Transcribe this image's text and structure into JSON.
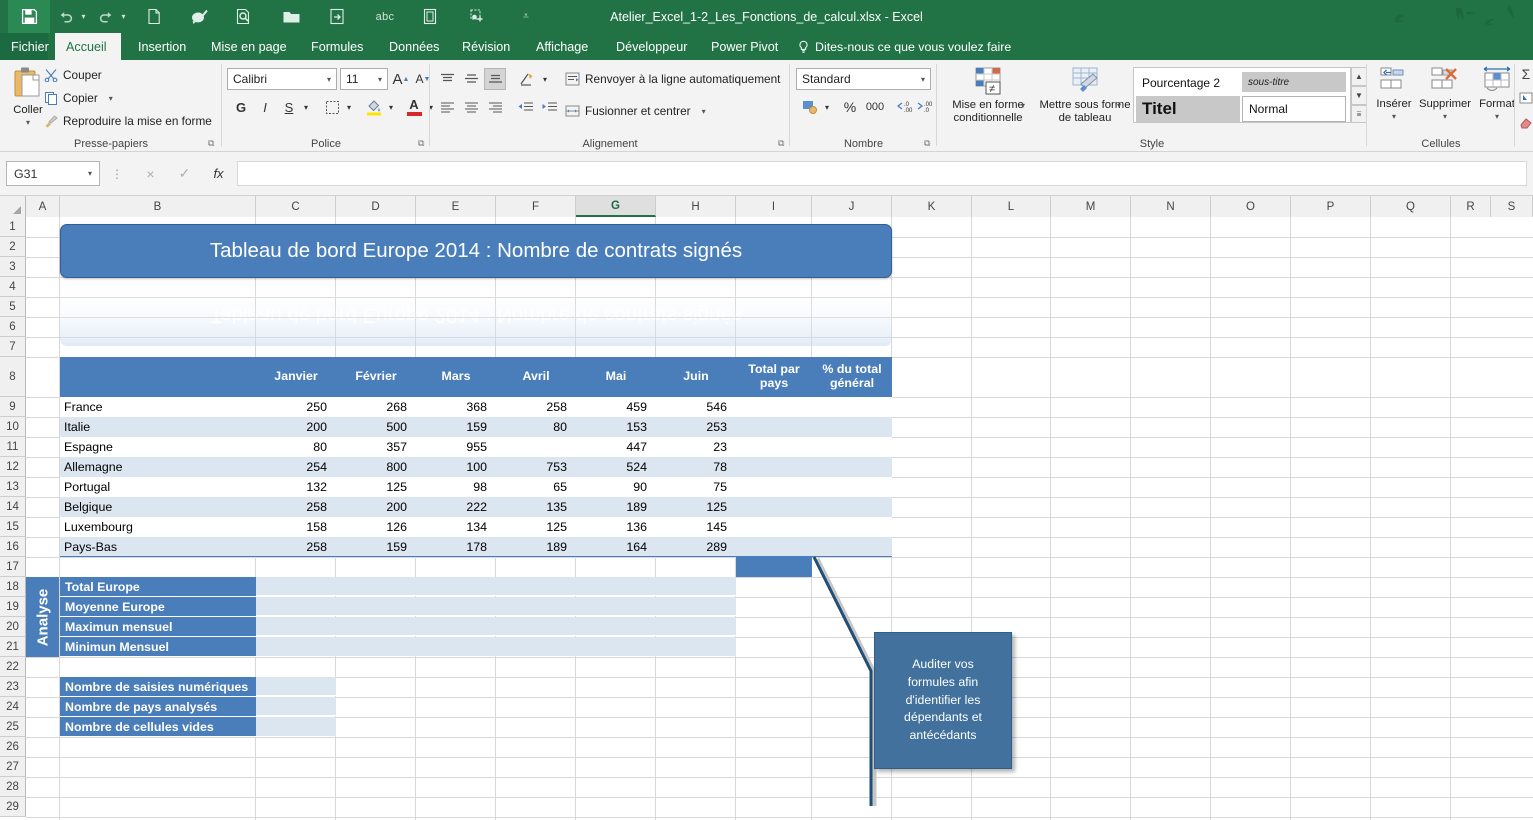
{
  "window": {
    "title": "Atelier_Excel_1-2_Les_Fonctions_de_calcul.xlsx - Excel",
    "accent_green": "#217346",
    "accent_blue": "#4a7ebb",
    "band_blue": "#dce6f1",
    "callout_blue": "#41719c"
  },
  "quick_access": {
    "icons": [
      {
        "name": "save-icon",
        "glyph": "ὋE"
      },
      {
        "name": "undo-icon",
        "glyph": "↶"
      },
      {
        "name": "redo-icon",
        "glyph": "↷"
      },
      {
        "name": "new-document-icon",
        "glyph": "὜B"
      },
      {
        "name": "spelling-check-icon",
        "glyph": "✓"
      },
      {
        "name": "print-preview-icon",
        "glyph": "ὐD"
      },
      {
        "name": "open-folder-icon",
        "glyph": "὜1"
      },
      {
        "name": "insert-function-icon",
        "glyph": "↵"
      },
      {
        "name": "abc-spelling-icon",
        "glyph": "abc"
      },
      {
        "name": "format-painter-icon",
        "glyph": "▣"
      },
      {
        "name": "add-command-icon",
        "glyph": "▦"
      },
      {
        "name": "customize-qat-icon",
        "glyph": "∇"
      }
    ]
  },
  "tabs": [
    {
      "label": "Fichier",
      "active": false,
      "file": true
    },
    {
      "label": "Accueil",
      "active": true,
      "file": false
    },
    {
      "label": "Insertion",
      "active": false,
      "file": false
    },
    {
      "label": "Mise en page",
      "active": false,
      "file": false
    },
    {
      "label": "Formules",
      "active": false,
      "file": false
    },
    {
      "label": "Données",
      "active": false,
      "file": false
    },
    {
      "label": "Révision",
      "active": false,
      "file": false
    },
    {
      "label": "Affichage",
      "active": false,
      "file": false
    },
    {
      "label": "Développeur",
      "active": false,
      "file": false
    },
    {
      "label": "Power Pivot",
      "active": false,
      "file": false
    }
  ],
  "tell_me": "Dites-nous ce que vous voulez faire",
  "ribbon": {
    "groups": [
      {
        "name": "Presse-papiers"
      },
      {
        "name": "Police"
      },
      {
        "name": "Alignement"
      },
      {
        "name": "Nombre"
      },
      {
        "name": "Style"
      },
      {
        "name": "Cellules"
      }
    ],
    "clipboard": {
      "paste": "Coller",
      "cut": "Couper",
      "copy": "Copier",
      "format_painter": "Reproduire la mise en forme"
    },
    "font": {
      "family": "Calibri",
      "size": "11",
      "bold": "G",
      "italic": "I",
      "underline": "S",
      "grow_font": "A",
      "shrink_font": "A"
    },
    "alignment": {
      "wrap_text": "Renvoyer à la ligne automatiquement",
      "merge_center": "Fusionner et centrer"
    },
    "number": {
      "format": "Standard",
      "percent": "%",
      "thousands": "000"
    },
    "styles": {
      "conditional_formatting": "Mise en forme conditionnelle",
      "format_as_table": "Mettre sous forme de tableau",
      "gallery": [
        {
          "label": "Pourcentage 2",
          "style": "percent2"
        },
        {
          "label": "sous-titre",
          "style": "subtitle"
        },
        {
          "label": "Titel",
          "style": "title"
        },
        {
          "label": "Normal",
          "style": "normal"
        }
      ]
    },
    "cells": {
      "insert": "Insérer",
      "delete": "Supprimer",
      "format": "Format"
    }
  },
  "formula_bar": {
    "name_box": "G31",
    "value": "",
    "cancel_icon": "×",
    "confirm_icon": "✓",
    "function_icon": "fx"
  },
  "sheet": {
    "columns": [
      "A",
      "B",
      "C",
      "D",
      "E",
      "F",
      "G",
      "H",
      "I",
      "J",
      "K",
      "L",
      "M",
      "N",
      "O",
      "P",
      "Q",
      "R",
      "S"
    ],
    "active_column": "G",
    "rows": [
      1,
      2,
      3,
      4,
      5,
      6,
      7,
      8,
      9,
      10,
      11,
      12,
      13,
      14,
      15,
      16,
      17,
      18,
      19,
      20,
      21,
      22,
      23,
      24,
      25,
      26,
      27,
      28,
      29
    ],
    "banner_title": "Tableau de bord Europe 2014 : Nombre de contrats signés",
    "table": {
      "headers": [
        "",
        "Janvier",
        "Février",
        "Mars",
        "Avril",
        "Mai",
        "Juin",
        "Total par pays",
        "% du total général"
      ],
      "rows": [
        {
          "country": "France",
          "values": [
            "250",
            "268",
            "368",
            "258",
            "459",
            "546"
          ],
          "total": "",
          "pct": ""
        },
        {
          "country": "Italie",
          "values": [
            "200",
            "500",
            "159",
            "80",
            "153",
            "253"
          ],
          "total": "",
          "pct": ""
        },
        {
          "country": "Espagne",
          "values": [
            "80",
            "357",
            "955",
            "",
            "447",
            "23"
          ],
          "total": "",
          "pct": ""
        },
        {
          "country": "Allemagne",
          "values": [
            "254",
            "800",
            "100",
            "753",
            "524",
            "78"
          ],
          "total": "",
          "pct": ""
        },
        {
          "country": "Portugal",
          "values": [
            "132",
            "125",
            "98",
            "65",
            "90",
            "75"
          ],
          "total": "",
          "pct": ""
        },
        {
          "country": "Belgique",
          "values": [
            "258",
            "200",
            "222",
            "135",
            "189",
            "125"
          ],
          "total": "",
          "pct": ""
        },
        {
          "country": "Luxembourg",
          "values": [
            "158",
            "126",
            "134",
            "125",
            "136",
            "145"
          ],
          "total": "",
          "pct": ""
        },
        {
          "country": "Pays-Bas",
          "values": [
            "258",
            "159",
            "178",
            "189",
            "164",
            "289"
          ],
          "total": "",
          "pct": ""
        }
      ]
    },
    "analysis": {
      "section_label": "Analyse",
      "items": [
        {
          "label": "Total Europe",
          "value": ""
        },
        {
          "label": "Moyenne Europe",
          "value": ""
        },
        {
          "label": "Maximun mensuel",
          "value": ""
        },
        {
          "label": "Minimun Mensuel",
          "value": ""
        }
      ],
      "counters": [
        {
          "label": "Nombre de saisies numériques",
          "value": ""
        },
        {
          "label": "Nombre de pays analysés",
          "value": ""
        },
        {
          "label": "Nombre de cellules vides",
          "value": ""
        }
      ]
    },
    "callout": {
      "text": "Auditer vos formules afin d'identifier les dépendants et antécédants"
    }
  }
}
